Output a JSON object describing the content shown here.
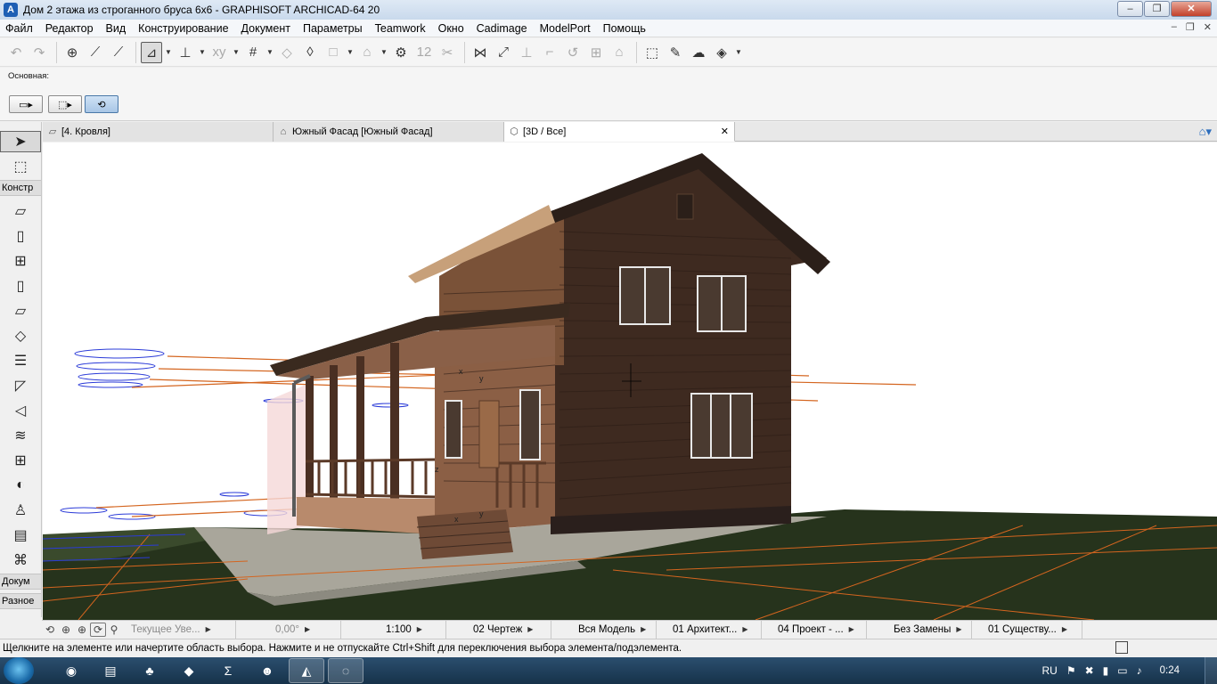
{
  "window": {
    "title": "Дом 2 этажа из строганного бруса 6х6 - GRAPHISOFT ARCHICAD-64 20",
    "app_icon": "archicad-icon",
    "minimize": "–",
    "maximize": "❐",
    "close": "✕"
  },
  "menu": {
    "items": [
      "Файл",
      "Редактор",
      "Вид",
      "Конструирование",
      "Документ",
      "Параметры",
      "Teamwork",
      "Окно",
      "Cadimage",
      "ModelPort",
      "Помощь"
    ],
    "mdi_min": "–",
    "mdi_restore": "❐",
    "mdi_close": "✕"
  },
  "toolbar": {
    "undo": "↶",
    "redo": "↷",
    "pick": "⊕",
    "eyedropper": "⟋",
    "inject": "⟋",
    "guide": "⊿",
    "guide_drop": "▼",
    "snap": "⊥",
    "snap_drop": "▼",
    "coords": "xy",
    "coords_drop": "▼",
    "grid": "#",
    "grid_drop": "▼",
    "plane": "◇",
    "edit_plane": "◊",
    "layer": "□",
    "layer_drop": "▼",
    "lock": "⌂",
    "lock_drop": "▼",
    "renovation": "⚙",
    "numbers": "12",
    "trim": "✂",
    "split": "⋈",
    "adjust": "⤢",
    "offset": "⊥",
    "fillet": "⌐",
    "curve": "↺",
    "resize": "⊞",
    "roof": "⌂",
    "select3d": "⬚",
    "pen": "✎",
    "cloud": "☁",
    "render": "◈",
    "render_drop": "▼"
  },
  "infobox": {
    "label": "Основная:",
    "geom1": "▭▸",
    "geom2": "⬚▸",
    "geom3": "⟲",
    "arrow": "➤ ▸"
  },
  "tabs": [
    {
      "label": "[4. Кровля]",
      "icon": "floorplan-icon"
    },
    {
      "label": "Южный Фасад [Южный Фасад]",
      "icon": "elevation-icon"
    },
    {
      "label": "[3D / Все]",
      "icon": "3d-icon",
      "close": "✕"
    }
  ],
  "navigator_icon": "⌂▾",
  "toolbox": {
    "arrow": "➤",
    "marquee": "⬚",
    "group_design": "Констр",
    "wall": "▱",
    "door": "▯",
    "window": "⊞",
    "column": "▯",
    "beam": "▱",
    "slab": "◇",
    "stair": "☰",
    "roof": "◸",
    "shell": "◁",
    "mesh": "≋",
    "curtain_wall": "⊞",
    "morph": "◐",
    "object": "♙",
    "zone": "▤",
    "railing": "⌘",
    "group_document": "Докум",
    "group_more": "Разное"
  },
  "quickbar": {
    "zoom_prev": "⟲",
    "zoom_in": "⊕",
    "zoom_fit": "⊕",
    "orbit": "⟳",
    "walk": "⚲",
    "zoom_label": "Текущее Уве...",
    "angle": "0,00°",
    "scale": "1:100",
    "layers": "02 Чертеж",
    "model_view": "Вся Модель",
    "pen_set": "01 Архитект...",
    "dim_std": "04 Проект - ...",
    "override": "Без Замены",
    "renovation": "01 Существу...",
    "arrow": "▶"
  },
  "status": {
    "message": "Щелкните на элементе или начертите область выбора. Нажмите и не отпускайте Ctrl+Shift для переключения выбора элемента/подэлемента."
  },
  "taskbar": {
    "apps": [
      "chrome-icon",
      "explorer-icon",
      "app-icon",
      "batman-icon",
      "sigma-icon",
      "game-icon",
      "archicad-icon",
      "archicad-alt-icon"
    ],
    "lang": "RU",
    "clock": "0:24"
  },
  "colors": {
    "wall_dark": "#3e2a20",
    "wall_light": "#8b5f45",
    "roof": "#2b1f19",
    "ground": "#26331c",
    "grid_orange": "#d4651f",
    "story_blue": "#2b3bd8"
  }
}
